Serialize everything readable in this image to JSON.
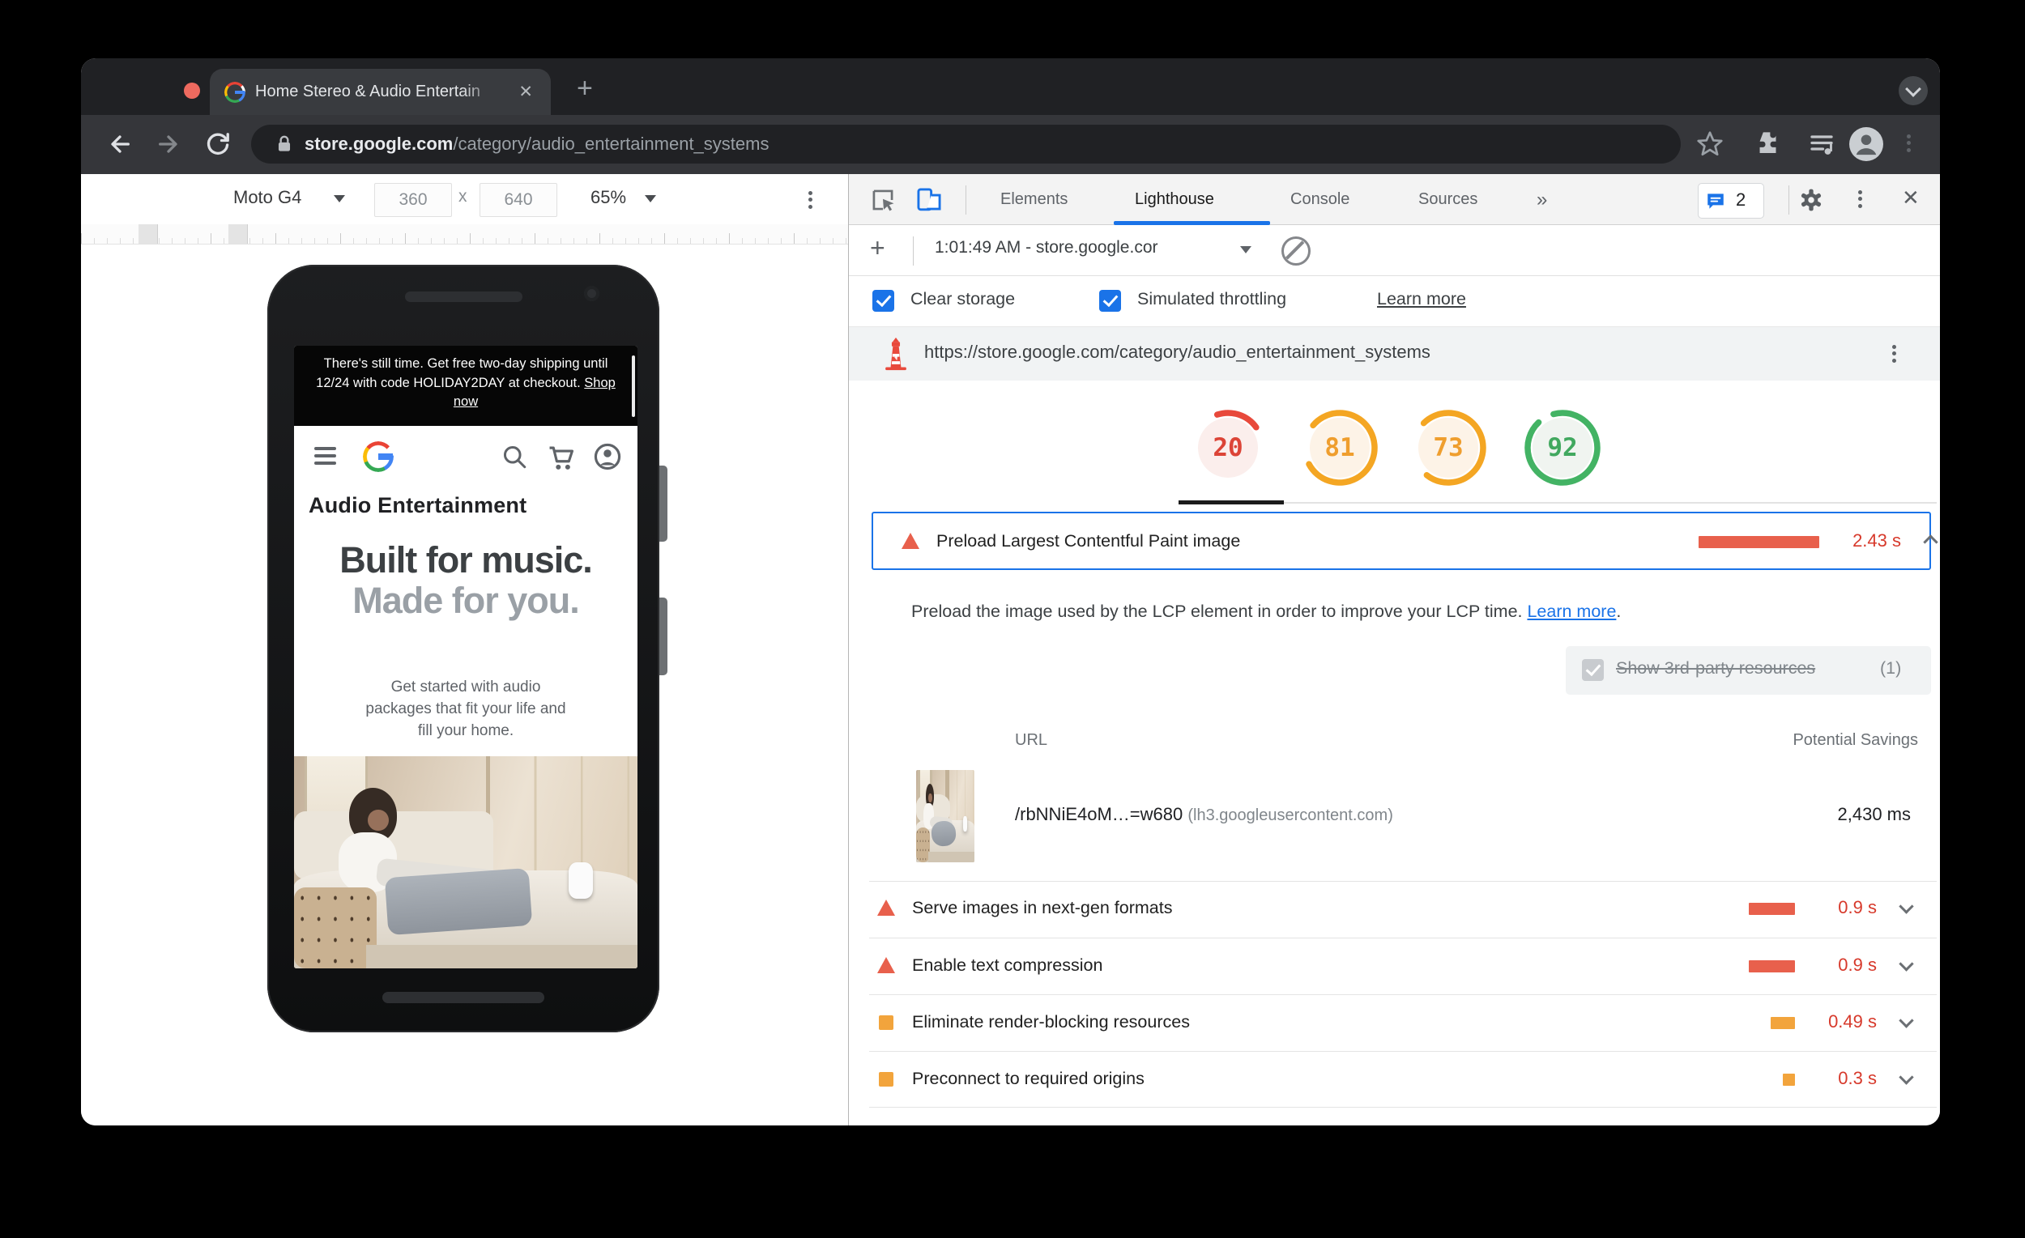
{
  "browser": {
    "tab_title": "Home Stereo & Audio Entertain",
    "url_host": "store.google.com",
    "url_path": "/category/audio_entertainment_systems"
  },
  "device_toolbar": {
    "device": "Moto G4",
    "width": "360",
    "height": "640",
    "multiply": "x",
    "zoom": "65%"
  },
  "phone": {
    "promo_text": "There's still time. Get free two-day shipping until 12/24 with code HOLIDAY2DAY at checkout. ",
    "promo_link": "Shop now",
    "heading": "Audio Entertainment",
    "hero_dark": "Built for music. ",
    "hero_gray": "Made for you.",
    "sub_lines": [
      "Get started with audio",
      "packages that fit your life and",
      "fill your home."
    ]
  },
  "devtools": {
    "tabs": [
      "Elements",
      "Lighthouse",
      "Console",
      "Sources"
    ],
    "more_tabs": "»",
    "issues_count": "2",
    "close_label": "✕",
    "new_run_label": "+",
    "run_label": "1:01:49 AM - store.google.cor",
    "clear_storage": "Clear storage",
    "throttling": "Simulated throttling",
    "learn_more": "Learn more",
    "audited_url": "https://store.google.com/category/audio_entertainment_systems"
  },
  "lighthouse": {
    "scores": [
      {
        "value": "20",
        "level": "poor"
      },
      {
        "value": "81",
        "level": "average"
      },
      {
        "value": "73",
        "level": "average"
      },
      {
        "value": "92",
        "level": "good"
      }
    ],
    "expanded_audit": {
      "title": "Preload Largest Contentful Paint image",
      "savings": "2.43 s",
      "description": "Preload the image used by the LCP element in order to improve your LCP time. ",
      "learn_more": "Learn more",
      "period": ".",
      "third_party_label": "Show 3rd-party resources",
      "third_party_count": " (1)",
      "col_url": "URL",
      "col_savings": "Potential Savings",
      "row_url": "/rbNNiE4oM…=w680",
      "row_host": "(lh3.googleusercontent.com)",
      "row_savings": "2,430 ms"
    },
    "audits": [
      {
        "title": "Serve images in next-gen formats",
        "savings": "0.9 s"
      },
      {
        "title": "Enable text compression",
        "savings": "0.9 s"
      },
      {
        "title": "Eliminate render-blocking resources",
        "savings": "0.49 s"
      },
      {
        "title": "Preconnect to required origins",
        "savings": "0.3 s"
      }
    ]
  },
  "colors": {
    "accent_blue": "#1a73e8",
    "fail_red": "#e8604c",
    "average_orange": "#f2a43c",
    "good_green": "#43b364",
    "savings_text": "#d7392b"
  }
}
